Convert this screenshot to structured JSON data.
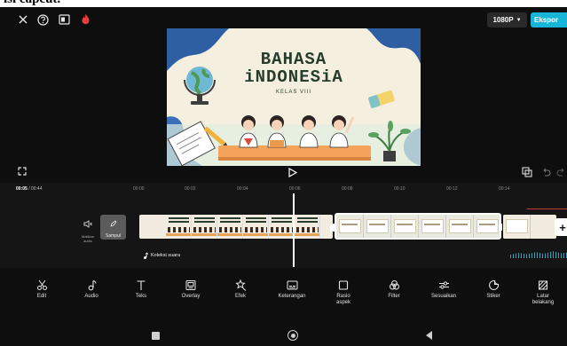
{
  "caption": "isi capcut.",
  "topbar": {
    "resolution": "1080P",
    "export_label": "Ekspor"
  },
  "icons": {
    "close": "close-icon",
    "help": "help-icon",
    "layout": "layout-icon",
    "flame": "flame-icon"
  },
  "preview": {
    "title_line1": "BAHASA",
    "title_line2": "iNDONESiA",
    "subtitle": "KELAS VIII"
  },
  "timeline": {
    "current_time": "00:05",
    "total_time": "00:44",
    "ticks": [
      "00:00",
      "00:02",
      "00:04",
      "00:06",
      "00:08",
      "00:10",
      "00:12",
      "00:14"
    ],
    "mute_label": "Matikan audio",
    "cover_label": "Sampul",
    "audio_track_label": "Koleksi suara"
  },
  "toolbar": [
    {
      "label": "Edit",
      "icon": "scissors-icon"
    },
    {
      "label": "Audio",
      "icon": "music-note-icon"
    },
    {
      "label": "Teks",
      "icon": "text-icon"
    },
    {
      "label": "Overlay",
      "icon": "overlay-icon"
    },
    {
      "label": "Efek",
      "icon": "effects-icon"
    },
    {
      "label": "Keterangan",
      "icon": "captions-icon"
    },
    {
      "label": "Rasio aspek",
      "icon": "aspect-ratio-icon"
    },
    {
      "label": "Filter",
      "icon": "filter-icon"
    },
    {
      "label": "Sesuaikan",
      "icon": "adjust-icon"
    },
    {
      "label": "Stiker",
      "icon": "sticker-icon"
    },
    {
      "label": "Latar belakang",
      "icon": "background-icon"
    }
  ],
  "colors": {
    "accent": "#17b6d8",
    "background": "#0e0e0e",
    "playhead": "#ffffff"
  }
}
